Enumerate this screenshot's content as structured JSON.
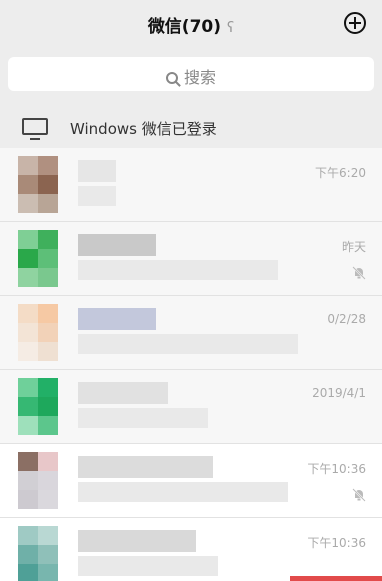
{
  "header": {
    "title": "微信(70)",
    "ear_icon": "ear-icon",
    "add_icon": "plus-circle-icon"
  },
  "search": {
    "placeholder": "搜索",
    "icon": "search-icon"
  },
  "pc_status": {
    "label": "Windows 微信已登录",
    "icon": "monitor-icon"
  },
  "chats": [
    {
      "time": "下午6:20",
      "muted": false
    },
    {
      "time": "昨天",
      "muted": true
    },
    {
      "time": "0/2/28",
      "muted": false
    },
    {
      "time": "2019/4/1",
      "muted": false
    },
    {
      "time": "下午10:36",
      "muted": true
    },
    {
      "time": "下午10:36",
      "muted": false
    }
  ],
  "colors": {
    "background": "#ededed",
    "text": "#111111",
    "muted_text": "#aaaaaa",
    "accent_red": "#e24b4b"
  }
}
